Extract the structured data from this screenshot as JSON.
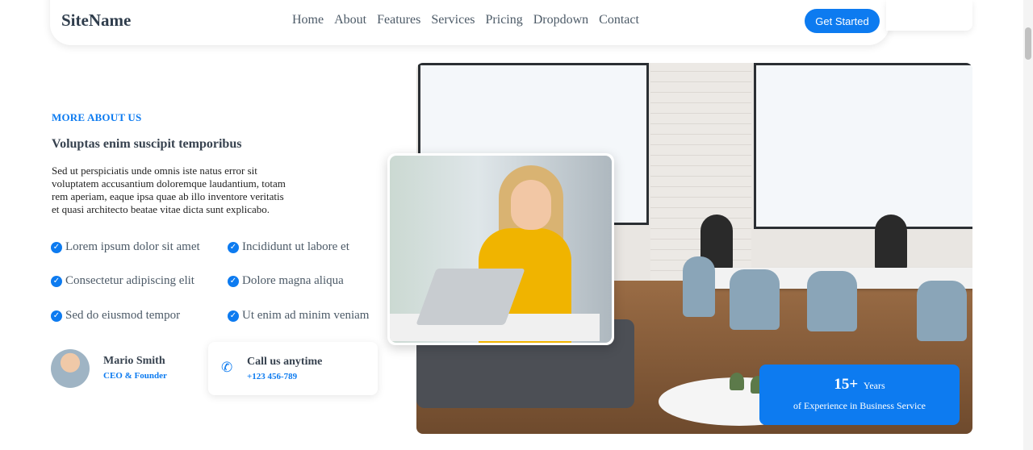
{
  "header": {
    "logo": "SiteName",
    "nav": [
      "Home",
      "About",
      "Features",
      "Services",
      "Pricing",
      "Dropdown",
      "Contact"
    ],
    "cta": "Get Started"
  },
  "about": {
    "eyebrow": "MORE ABOUT US",
    "heading": "Voluptas enim suscipit temporibus",
    "description": "Sed ut perspiciatis unde omnis iste natus error sit voluptatem accusantium doloremque laudantium, totam rem aperiam, eaque ipsa quae ab illo inventore veritatis et quasi architecto beatae vitae dicta sunt explicabo.",
    "features": [
      "Lorem ipsum dolor sit amet",
      "Incididunt ut labore et",
      "Consectetur adipiscing elit",
      "Dolore magna aliqua",
      "Sed do eiusmod tempor",
      "Ut enim ad minim veniam"
    ],
    "person": {
      "name": "Mario Smith",
      "role": "CEO & Founder"
    },
    "call": {
      "title": "Call us anytime",
      "phone": "+123 456-789"
    }
  },
  "experience": {
    "number": "15+",
    "unit": "Years",
    "text": "of Experience in Business Service"
  },
  "colors": {
    "accent": "#0d7bf0",
    "text": "#37424f"
  },
  "icons": {
    "check": "check-circle-icon",
    "phone": "phone-icon"
  }
}
